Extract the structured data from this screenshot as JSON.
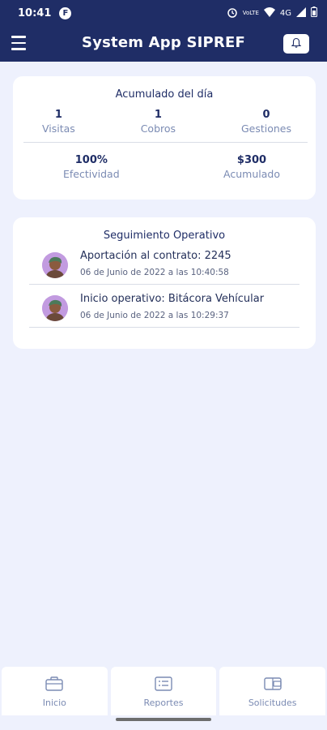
{
  "status_bar": {
    "time": "10:41",
    "badge": "F",
    "network_label": "4G",
    "volte_label": "VoLTE"
  },
  "app_bar": {
    "title": "System App SIPREF"
  },
  "daily_summary": {
    "title": "Acumulado del día",
    "stats_row1": [
      {
        "value": "1",
        "label": "Visitas"
      },
      {
        "value": "1",
        "label": "Cobros"
      },
      {
        "value": "0",
        "label": "Gestiones"
      }
    ],
    "stats_row2": [
      {
        "value": "100%",
        "label": "Efectividad"
      },
      {
        "value": "$300",
        "label": "Acumulado"
      }
    ]
  },
  "tracking": {
    "title": "Seguimiento Operativo",
    "items": [
      {
        "title": "Aportación al contrato: 2245",
        "date": "06 de Junio de 2022 a las 10:40:58"
      },
      {
        "title": "Inicio operativo: Bitácora Vehícular",
        "date": "06 de Junio de 2022 a las 10:29:37"
      }
    ]
  },
  "bottom_nav": [
    {
      "label": "Inicio",
      "icon": "briefcase-icon"
    },
    {
      "label": "Reportes",
      "icon": "list-icon"
    },
    {
      "label": "Solicitudes",
      "icon": "wallet-icon"
    }
  ],
  "colors": {
    "primary": "#1f2d66",
    "background": "#eef1fd",
    "muted_text": "#7b8bb3"
  }
}
